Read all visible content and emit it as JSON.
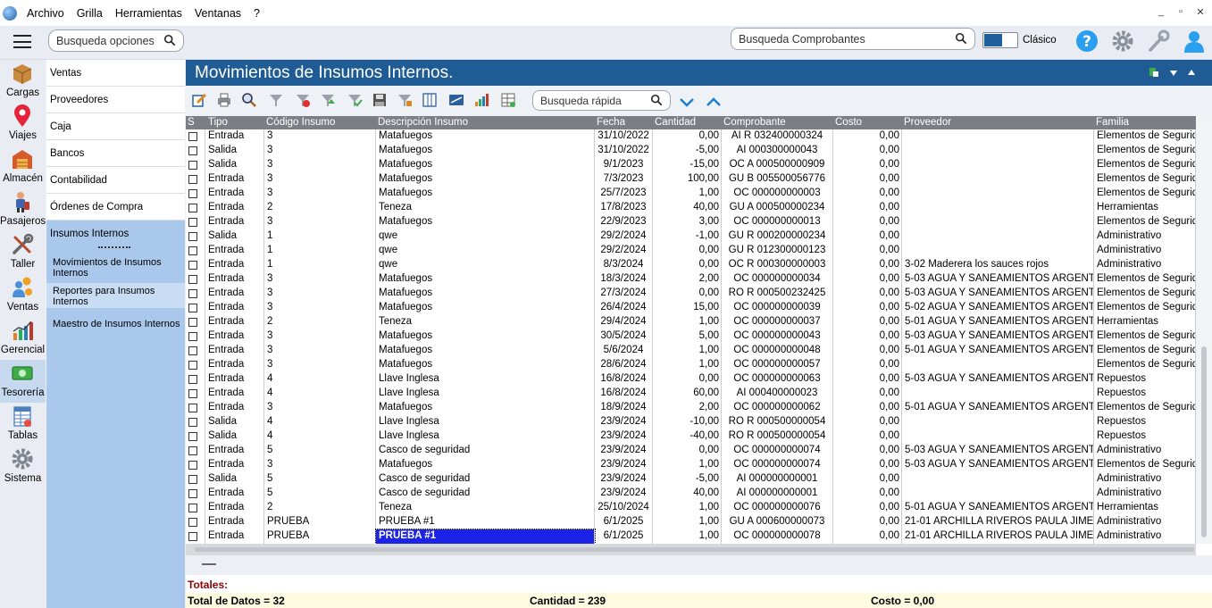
{
  "menu": {
    "items": [
      "Archivo",
      "Grilla",
      "Herramientas",
      "Ventanas",
      "?"
    ],
    "window_controls": [
      "_",
      "▫",
      "✕"
    ]
  },
  "topbar": {
    "search_options_placeholder": "Busqueda opciones",
    "search_receipts_placeholder": "Busqueda Comprobantes",
    "mode_label": "Clásico",
    "icons": [
      "help-icon",
      "gear-icon",
      "wrench-icon",
      "user-icon"
    ]
  },
  "nav": [
    {
      "label": "Cargas",
      "icon": "box-icon"
    },
    {
      "label": "Viajes",
      "icon": "map-pin-icon"
    },
    {
      "label": "Almacén",
      "icon": "warehouse-icon"
    },
    {
      "label": "Pasajeros",
      "icon": "passenger-icon"
    },
    {
      "label": "Taller",
      "icon": "tools-icon"
    },
    {
      "label": "Ventas",
      "icon": "sales-icon"
    },
    {
      "label": "Gerencial",
      "icon": "bar-chart-icon"
    },
    {
      "label": "Tesorería",
      "icon": "money-icon",
      "active": true
    },
    {
      "label": "Tablas",
      "icon": "table-icon"
    },
    {
      "label": "Sistema",
      "icon": "gear-icon"
    }
  ],
  "sidebar": {
    "items": [
      "Ventas",
      "Proveedores",
      "Caja",
      "Bancos",
      "Contabilidad",
      "Órdenes de Compra",
      "Insumos Internos"
    ],
    "subitems": [
      "Movimientos de Insumos Internos",
      "Reportes para Insumos Internos",
      "Maestro de Insumos Internos"
    ]
  },
  "main": {
    "title": "Movimientos de Insumos Internos.",
    "quick_search_placeholder": "Busqueda rápida",
    "columns": [
      "S",
      "Tipo",
      "Código Insumo",
      "Descripción Insumo",
      "Fecha",
      "Cantidad",
      "Comprobante",
      "Costo",
      "Proveedor",
      "Familia"
    ],
    "rows": [
      [
        "Entrada",
        "3",
        "Matafuegos",
        "31/10/2022",
        "0,00",
        "AI R 032400000324",
        "0,00",
        "",
        "Elementos de Seguridad"
      ],
      [
        "Salida",
        "3",
        "Matafuegos",
        "31/10/2022",
        "-5,00",
        "AI  000300000043",
        "0,00",
        "",
        "Elementos de Seguridad"
      ],
      [
        "Salida",
        "3",
        "Matafuegos",
        "9/1/2023",
        "-15,00",
        "OC A 000500000909",
        "0,00",
        "",
        "Elementos de Seguridad"
      ],
      [
        "Entrada",
        "3",
        "Matafuegos",
        "7/3/2023",
        "100,00",
        "GU B 005500056776",
        "0,00",
        "",
        "Elementos de Seguridad"
      ],
      [
        "Entrada",
        "3",
        "Matafuegos",
        "25/7/2023",
        "1,00",
        "OC  000000000003",
        "0,00",
        "",
        "Elementos de Seguridad"
      ],
      [
        "Entrada",
        "2",
        "Teneza",
        "17/8/2023",
        "40,00",
        "GU A 000500000234",
        "0,00",
        "",
        "Herramientas"
      ],
      [
        "Entrada",
        "3",
        "Matafuegos",
        "22/9/2023",
        "3,00",
        "OC  000000000013",
        "0,00",
        "",
        "Elementos de Seguridad"
      ],
      [
        "Salida",
        "1",
        "qwe",
        "29/2/2024",
        "-1,00",
        "GU R 000200000234",
        "0,00",
        "",
        "Administrativo"
      ],
      [
        "Entrada",
        "1",
        "qwe",
        "29/2/2024",
        "0,00",
        "GU R 012300000123",
        "0,00",
        "",
        "Administrativo"
      ],
      [
        "Entrada",
        "1",
        "qwe",
        "8/3/2024",
        "0,00",
        "OC R 000300000003",
        "0,00",
        "3-02 Maderera los sauces rojos",
        "Administrativo"
      ],
      [
        "Entrada",
        "3",
        "Matafuegos",
        "18/3/2024",
        "2,00",
        "OC  000000000034",
        "0,00",
        "5-03 AGUA Y SANEAMIENTOS ARGENTINOS",
        "Elementos de Seguridad"
      ],
      [
        "Entrada",
        "3",
        "Matafuegos",
        "27/3/2024",
        "0,00",
        "RO R 000500232425",
        "0,00",
        "5-03 AGUA Y SANEAMIENTOS ARGENTINOS",
        "Elementos de Seguridad"
      ],
      [
        "Entrada",
        "3",
        "Matafuegos",
        "26/4/2024",
        "15,00",
        "OC  000000000039",
        "0,00",
        "5-02 AGUA Y SANEAMIENTOS ARGENTINOS",
        "Elementos de Seguridad"
      ],
      [
        "Entrada",
        "2",
        "Teneza",
        "29/4/2024",
        "1,00",
        "OC  000000000037",
        "0,00",
        "5-01 AGUA Y SANEAMIENTOS ARGENTINOS",
        "Herramientas"
      ],
      [
        "Entrada",
        "3",
        "Matafuegos",
        "30/5/2024",
        "5,00",
        "OC  000000000043",
        "0,00",
        "5-03 AGUA Y SANEAMIENTOS ARGENTINOS",
        "Elementos de Seguridad"
      ],
      [
        "Entrada",
        "3",
        "Matafuegos",
        "5/6/2024",
        "1,00",
        "OC  000000000048",
        "0,00",
        "5-01 AGUA Y SANEAMIENTOS ARGENTINOS",
        "Elementos de Seguridad"
      ],
      [
        "Entrada",
        "3",
        "Matafuegos",
        "28/6/2024",
        "1,00",
        "OC  000000000057",
        "0,00",
        "",
        "Elementos de Seguridad"
      ],
      [
        "Entrada",
        "4",
        "Llave Inglesa",
        "16/8/2024",
        "0,00",
        "OC  000000000063",
        "0,00",
        "5-03 AGUA Y SANEAMIENTOS ARGENTINOS",
        "Repuestos"
      ],
      [
        "Entrada",
        "4",
        "Llave Inglesa",
        "16/8/2024",
        "60,00",
        "AI  000400000023",
        "0,00",
        "",
        "Repuestos"
      ],
      [
        "Entrada",
        "3",
        "Matafuegos",
        "18/9/2024",
        "2,00",
        "OC  000000000062",
        "0,00",
        "5-01 AGUA Y SANEAMIENTOS ARGENTINOS",
        "Elementos de Seguridad"
      ],
      [
        "Salida",
        "4",
        "Llave Inglesa",
        "23/9/2024",
        "-10,00",
        "RO R 000500000054",
        "0,00",
        "",
        "Repuestos"
      ],
      [
        "Salida",
        "4",
        "Llave Inglesa",
        "23/9/2024",
        "-40,00",
        "RO R 000500000054",
        "0,00",
        "",
        "Repuestos"
      ],
      [
        "Entrada",
        "5",
        "Casco de seguridad",
        "23/9/2024",
        "0,00",
        "OC  000000000074",
        "0,00",
        "5-03 AGUA Y SANEAMIENTOS ARGENTINOS",
        "Administrativo"
      ],
      [
        "Entrada",
        "3",
        "Matafuegos",
        "23/9/2024",
        "1,00",
        "OC  000000000074",
        "0,00",
        "5-03 AGUA Y SANEAMIENTOS ARGENTINOS",
        "Elementos de Seguridad"
      ],
      [
        "Salida",
        "5",
        "Casco de seguridad",
        "23/9/2024",
        "-5,00",
        "AI  000000000001",
        "0,00",
        "",
        "Administrativo"
      ],
      [
        "Entrada",
        "5",
        "Casco de seguridad",
        "23/9/2024",
        "40,00",
        "AI  000000000001",
        "0,00",
        "",
        "Administrativo"
      ],
      [
        "Entrada",
        "2",
        "Teneza",
        "25/10/2024",
        "1,00",
        "OC  000000000076",
        "0,00",
        "5-01 AGUA Y SANEAMIENTOS ARGENTINOS",
        "Herramientas"
      ],
      [
        "Entrada",
        "PRUEBA",
        "PRUEBA #1",
        "6/1/2025",
        "1,00",
        "GU A 000600000073",
        "0,00",
        "21-01 ARCHILLA RIVEROS PAULA JIMENA",
        "Administrativo"
      ],
      [
        "Entrada",
        "PRUEBA",
        "PRUEBA #1",
        "6/1/2025",
        "1,00",
        "OC  000000000078",
        "0,00",
        "21-01 ARCHILLA RIVEROS PAULA JIMENA",
        "Administrativo"
      ]
    ],
    "selected_row": 28,
    "totals": {
      "label": "Totales:",
      "total_datos": "Total de Datos = 32",
      "cantidad": "Cantidad = 239",
      "costo": "Costo = 0,00"
    }
  },
  "colors": {
    "accent": "#1f5c95",
    "selection": "#1a23e6",
    "sidebar": "#a9c8ec"
  }
}
